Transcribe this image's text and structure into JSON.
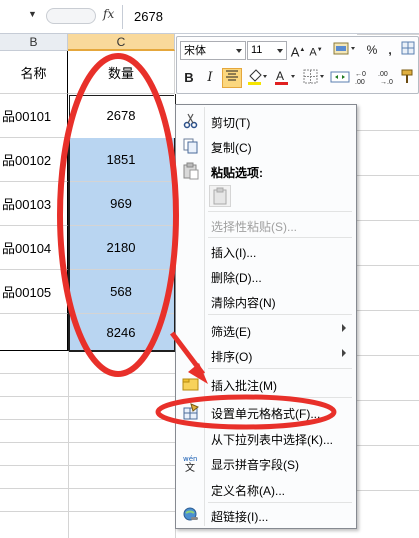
{
  "formula_bar": {
    "fx_label": "fx",
    "value": "2678"
  },
  "columns": [
    {
      "label": "B"
    },
    {
      "label": "C"
    }
  ],
  "table": {
    "header": {
      "name": "名称",
      "qty": "数量"
    },
    "rows": [
      {
        "name": "品00101",
        "qty": "2678"
      },
      {
        "name": "品00102",
        "qty": "1851"
      },
      {
        "name": "品00103",
        "qty": "969"
      },
      {
        "name": "品00104",
        "qty": "2180"
      },
      {
        "name": "品00105",
        "qty": "568"
      },
      {
        "name": "",
        "qty": "8246"
      }
    ]
  },
  "mini_toolbar": {
    "font_name": "宋体",
    "font_size": "11",
    "bold": "B",
    "italic": "I",
    "percent": "%",
    "comma": ","
  },
  "context_menu": {
    "items": [
      {
        "label": "剪切(T)",
        "icon": "scissors-icon"
      },
      {
        "label": "复制(C)",
        "icon": "copy-icon"
      },
      {
        "label": "粘贴选项:",
        "icon": "paste-icon"
      },
      {
        "label": "选择性粘贴(S)...",
        "disabled": true
      },
      {
        "label": "插入(I)..."
      },
      {
        "label": "删除(D)..."
      },
      {
        "label": "清除内容(N)"
      },
      {
        "label": "筛选(E)",
        "submenu": true
      },
      {
        "label": "排序(O)",
        "submenu": true
      },
      {
        "label": "插入批注(M)",
        "icon": "comment-icon"
      },
      {
        "label": "设置单元格格式(F)...",
        "icon": "format-cells-icon"
      },
      {
        "label": "从下拉列表中选择(K)..."
      },
      {
        "label": "显示拼音字段(S)",
        "icon": "phonetic-icon"
      },
      {
        "label": "定义名称(A)..."
      },
      {
        "label": "超链接(I)...",
        "icon": "hyperlink-icon"
      }
    ]
  },
  "annotation_color": "#e8302a",
  "selection_color": "#b9d5f1"
}
